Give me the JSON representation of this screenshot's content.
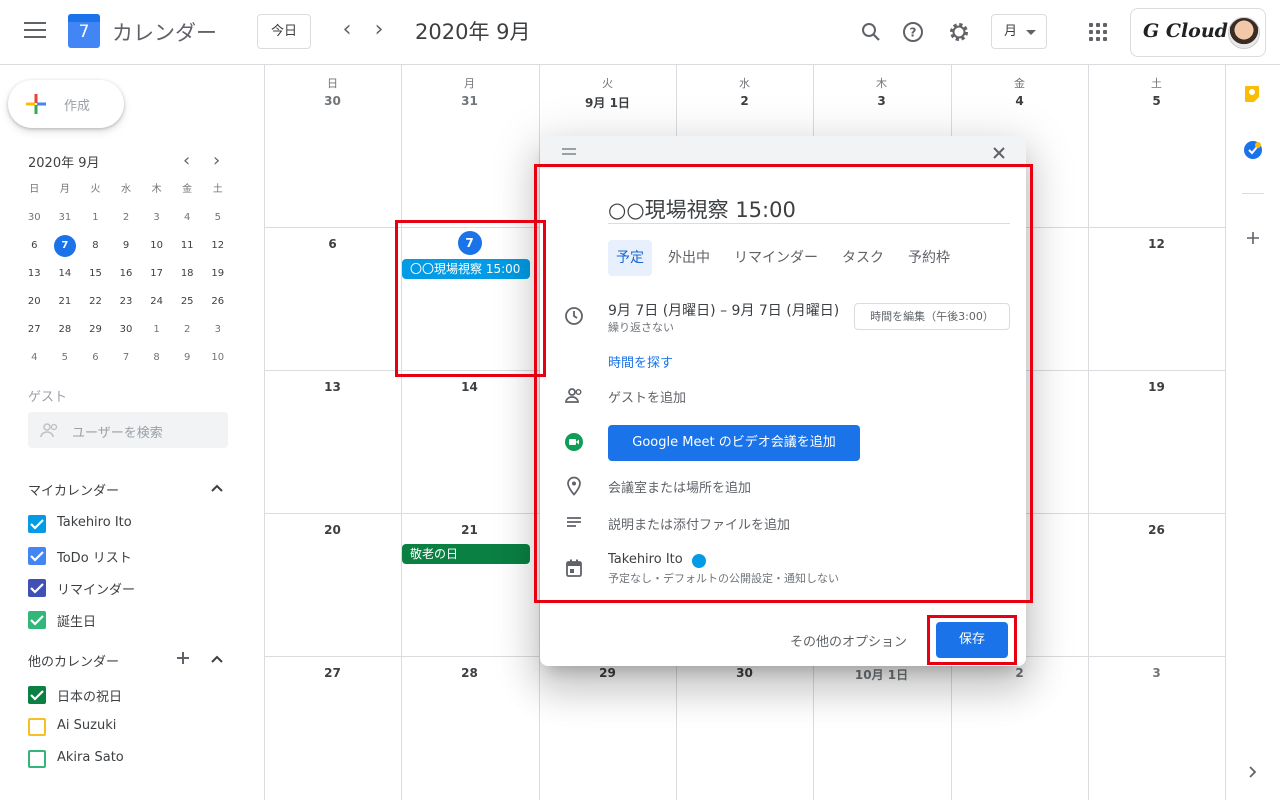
{
  "header": {
    "logo_day": "7",
    "app_title": "カレンダー",
    "today_label": "今日",
    "prev_label": "‹",
    "next_label": "›",
    "month_title": "2020年 9月",
    "view_label": "月",
    "brand_text": "G Cloud"
  },
  "sidebar": {
    "create_label": "作成",
    "mini_title": "2020年 9月",
    "mini_prev": "‹",
    "mini_next": "›",
    "mini_headers": [
      "日",
      "月",
      "火",
      "水",
      "木",
      "金",
      "土"
    ],
    "mini_weeks": [
      [
        "30",
        "31",
        "1",
        "2",
        "3",
        "4",
        "5"
      ],
      [
        "6",
        "7",
        "8",
        "9",
        "10",
        "11",
        "12"
      ],
      [
        "13",
        "14",
        "15",
        "16",
        "17",
        "18",
        "19"
      ],
      [
        "20",
        "21",
        "22",
        "23",
        "24",
        "25",
        "26"
      ],
      [
        "27",
        "28",
        "29",
        "30",
        "1",
        "2",
        "3"
      ],
      [
        "4",
        "5",
        "6",
        "7",
        "8",
        "9",
        "10"
      ]
    ],
    "guest_label": "ゲスト",
    "user_search_placeholder": "ユーザーを検索",
    "my_calendars_title": "マイカレンダー",
    "my_calendars": [
      {
        "label": "Takehiro Ito",
        "color": "#039be5",
        "checked": true
      },
      {
        "label": "ToDo リスト",
        "color": "#4285f4",
        "checked": true
      },
      {
        "label": "リマインダー",
        "color": "#3f51b5",
        "checked": true
      },
      {
        "label": "誕生日",
        "color": "#33b679",
        "checked": true
      }
    ],
    "other_calendars_title": "他のカレンダー",
    "other_calendars": [
      {
        "label": "日本の祝日",
        "color": "#0b8043",
        "checked": true
      },
      {
        "label": "Ai Suzuki",
        "color": "#f6bf26",
        "checked": false
      },
      {
        "label": "Akira Sato",
        "color": "#33b679",
        "checked": false
      }
    ]
  },
  "grid": {
    "weekdays": [
      "日",
      "月",
      "火",
      "水",
      "木",
      "金",
      "土"
    ],
    "week1": [
      "30",
      "31",
      "9月 1日",
      "2",
      "3",
      "4",
      "5"
    ],
    "week2": [
      "6",
      "7",
      "",
      "",
      "",
      "",
      "12"
    ],
    "week3": [
      "13",
      "14",
      "",
      "",
      "",
      "",
      "19"
    ],
    "week4": [
      "20",
      "21",
      "",
      "",
      "",
      "",
      "26"
    ],
    "week5": [
      "27",
      "28",
      "29",
      "30",
      "10月 1日",
      "2",
      "3"
    ],
    "events": {
      "new_event": "〇〇現場視察 15:00",
      "holiday": "敬老の日"
    }
  },
  "dialog": {
    "title": "○○現場視察 15:00",
    "tabs": [
      "予定",
      "外出中",
      "リマインダー",
      "タスク",
      "予約枠"
    ],
    "date_range": "9月 7日 (月曜日)  –  9月 7日 (月曜日)",
    "repeat": "繰り返さない",
    "edit_time": "時間を編集（午後3:00）",
    "find_time": "時間を探す",
    "add_guests": "ゲストを追加",
    "meet_button": "Google Meet のビデオ会議を追加",
    "add_location": "会議室または場所を追加",
    "add_description": "説明または添付ファイルを追加",
    "owner": "Takehiro Ito",
    "owner_settings": "予定なし・デフォルトの公開設定・通知しない",
    "more_options": "その他のオプション",
    "save": "保存"
  },
  "colors": {
    "accent": "#1a73e8",
    "event_chip": "#039be5",
    "holiday_chip": "#0b8043",
    "highlight": "#e60012"
  }
}
